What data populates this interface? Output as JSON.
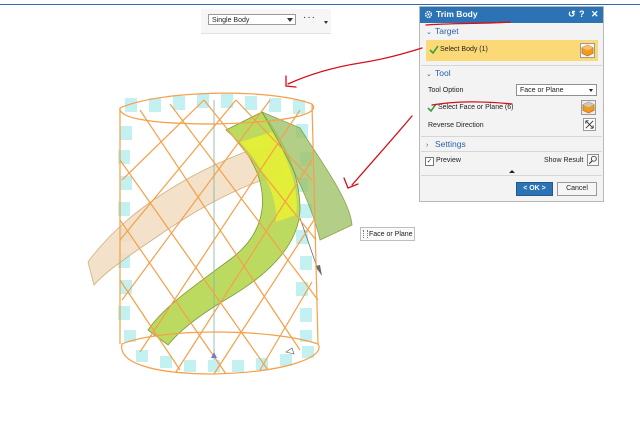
{
  "selection_bar": {
    "filter_value": "Single Body",
    "more_glyph": "···"
  },
  "viewport": {
    "tooltip_text": "Face or Plane",
    "colors": {
      "sleeve_surface": "#bdeff0",
      "helix_curves": "#f5a04a",
      "ribbon_surface": "#b5d64f",
      "back_ribbon": "#f2ddc0"
    }
  },
  "dialog": {
    "title": "Trim Body",
    "title_icons": [
      "gear-icon",
      "reset-icon",
      "help-icon",
      "close-icon"
    ],
    "reset_glyph": "↺",
    "help_glyph": "?",
    "close_glyph": "✕",
    "sections": {
      "target": {
        "label": "Target",
        "select_label": "Select Body (1)"
      },
      "tool": {
        "label": "Tool",
        "tool_option_label": "Tool Option",
        "tool_option_value": "Face or Plane",
        "select_label": "Select Face or Plane (6)",
        "reverse_label": "Reverse Direction"
      },
      "settings": {
        "label": "Settings"
      }
    },
    "preview_label": "Preview",
    "preview_checked": true,
    "show_result_label": "Show Result",
    "ok_label": "< OK >",
    "cancel_label": "Cancel",
    "accent_color": "#2b73b5",
    "highlight_color": "#fbd977"
  },
  "annotations": {
    "pen_color": "#d6101a"
  }
}
